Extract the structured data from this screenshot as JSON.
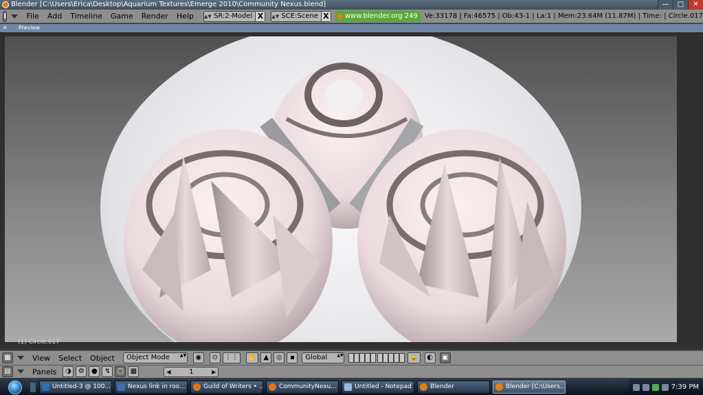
{
  "window": {
    "title": "Blender [C:\\Users\\Erica\\Desktop\\Aquarium Textures\\Emerge 2010\\Community Nexus.blend]",
    "minimize": "—",
    "maximize": "□",
    "close": "✕"
  },
  "menubar": {
    "info_icon": "i",
    "menus": [
      "File",
      "Add",
      "Timeline",
      "Game",
      "Render",
      "Help"
    ],
    "screen_field": "SR:2-Model",
    "scene_field": "SCE:Scene",
    "close_glyph": "X",
    "blender_link": "www.blender.org 249",
    "stats": "Ve:33178 | Fa:46575 | Ob:43-1 | La:1  | Mem:23.64M (11.87M)  | Time: | Circle.017"
  },
  "preview": {
    "close": "✕",
    "label": "Preview"
  },
  "viewport": {
    "object_label": "(1) Circle.017"
  },
  "view_header": {
    "menus": [
      "View",
      "Select",
      "Object"
    ],
    "mode": "Object Mode",
    "transform": "Global"
  },
  "buttons_header": {
    "label": "Panels",
    "frame": "1",
    "left_arrow": "◀",
    "right_arrow": "▶"
  },
  "taskbar": {
    "tasks": [
      {
        "label": "Untitled-3 @ 100...",
        "color": "#2a6fb5"
      },
      {
        "label": "Nexus link in roo...",
        "color": "#3b6fb0"
      },
      {
        "label": "Guild of Writers • ...",
        "color": "#e8741a"
      },
      {
        "label": "CommunityNexu...",
        "color": "#e8741a"
      },
      {
        "label": "Untitled - Notepad",
        "color": "#9ab8d8"
      },
      {
        "label": "Blender",
        "color": "#e87d0d"
      },
      {
        "label": "Blender [C:\\Users...",
        "color": "#e87d0d"
      }
    ],
    "clock": "7:39 PM"
  },
  "colors": {
    "accent": "#5aa83a",
    "preview_bar": "#6f86a6",
    "panel": "#8e8e8e"
  }
}
